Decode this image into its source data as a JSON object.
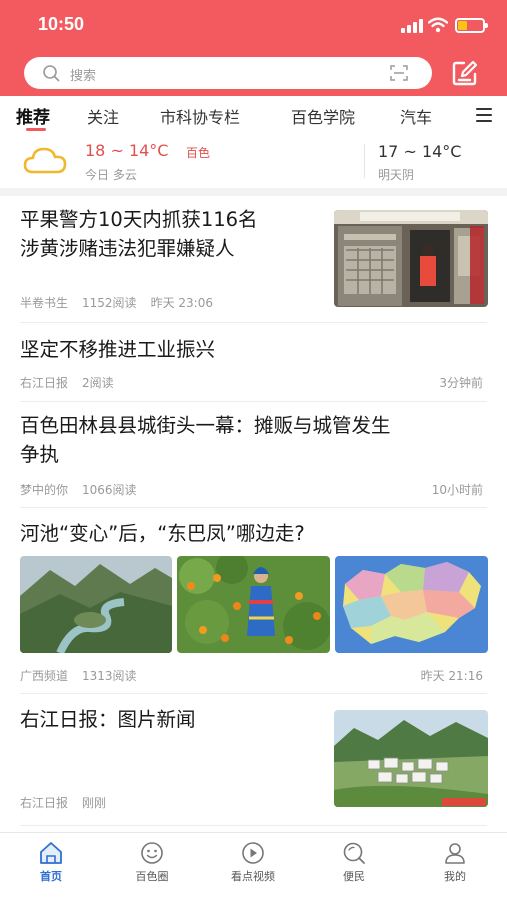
{
  "status_bar": {
    "time": "10:50"
  },
  "search": {
    "placeholder": "搜索"
  },
  "tabs": [
    {
      "label": "推荐",
      "active": true
    },
    {
      "label": "关注"
    },
    {
      "label": "市科协专栏"
    },
    {
      "label": "百色学院"
    },
    {
      "label": "汽车"
    }
  ],
  "weather": {
    "today_temp": "18 ~ 14°C",
    "city": "百色",
    "today_label": "今日 多云",
    "tomorrow_temp": "17 ~ 14°C",
    "tomorrow_label": "明天阴"
  },
  "news": [
    {
      "title_lines": [
        "平果警方10天内抓获116名",
        "涉黄涉赌违法犯罪嫌疑人"
      ],
      "source": "半卷书生",
      "reads": "1152阅读",
      "time": "昨天 23:06",
      "image": "shop-front-photo"
    },
    {
      "title_lines": [
        "坚定不移推进工业振兴"
      ],
      "source": "右江日报",
      "reads": "2阅读",
      "time": "3分钟前"
    },
    {
      "title_lines": [
        "百色田林县县城街头一幕：摊贩与城管发生",
        "争执"
      ],
      "source": "梦中的你",
      "reads": "1066阅读",
      "time": "10小时前"
    },
    {
      "title_lines": [
        "河池“变心”后，“东巴凤”哪边走?"
      ],
      "source": "广西频道",
      "reads": "1313阅读",
      "time": "昨天 21:16",
      "images": [
        "river-valley-photo",
        "orange-harvest-photo",
        "province-map-image"
      ]
    },
    {
      "title_lines": [
        "右江日报：图片新闻"
      ],
      "source": "右江日报",
      "reads": "刚刚",
      "time": "",
      "image": "village-landscape-photo"
    }
  ],
  "bottom_nav": [
    {
      "label": "首页",
      "icon": "home-icon",
      "active": true
    },
    {
      "label": "百色圈",
      "icon": "smile-circle-icon"
    },
    {
      "label": "看点视频",
      "icon": "play-icon"
    },
    {
      "label": "便民",
      "icon": "search-bubble-icon"
    },
    {
      "label": "我的",
      "icon": "user-icon"
    }
  ],
  "colors": {
    "brand": "#f25a5f",
    "nav_active": "#2f6fd1"
  }
}
